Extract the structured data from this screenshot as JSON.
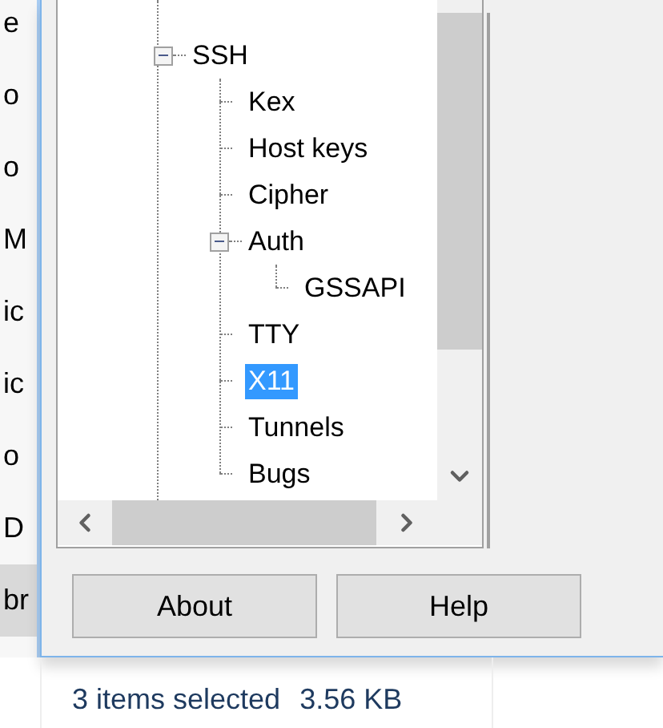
{
  "background_list": [
    {
      "label": "e",
      "selected": false
    },
    {
      "label": "o",
      "selected": false
    },
    {
      "label": "o",
      "selected": false
    },
    {
      "label": "M",
      "selected": false
    },
    {
      "label": "ic",
      "selected": false
    },
    {
      "label": "ic",
      "selected": false
    },
    {
      "label": "o",
      "selected": false
    },
    {
      "label": "D",
      "selected": false
    },
    {
      "label": "br",
      "selected": true
    }
  ],
  "tree": [
    {
      "label": "SSH",
      "expanded": true,
      "selected": false,
      "children": [
        {
          "label": "Kex",
          "selected": false
        },
        {
          "label": "Host keys",
          "selected": false
        },
        {
          "label": "Cipher",
          "selected": false
        },
        {
          "label": "Auth",
          "expanded": true,
          "selected": false,
          "children": [
            {
              "label": "GSSAPI",
              "selected": false
            }
          ]
        },
        {
          "label": "TTY",
          "selected": false
        },
        {
          "label": "X11",
          "selected": true
        },
        {
          "label": "Tunnels",
          "selected": false
        },
        {
          "label": "Bugs",
          "selected": false
        }
      ]
    }
  ],
  "buttons": [
    {
      "label": "About"
    },
    {
      "label": "Help"
    }
  ],
  "status_bar": {
    "selection": "3 items selected",
    "size": "3.56 KB"
  }
}
